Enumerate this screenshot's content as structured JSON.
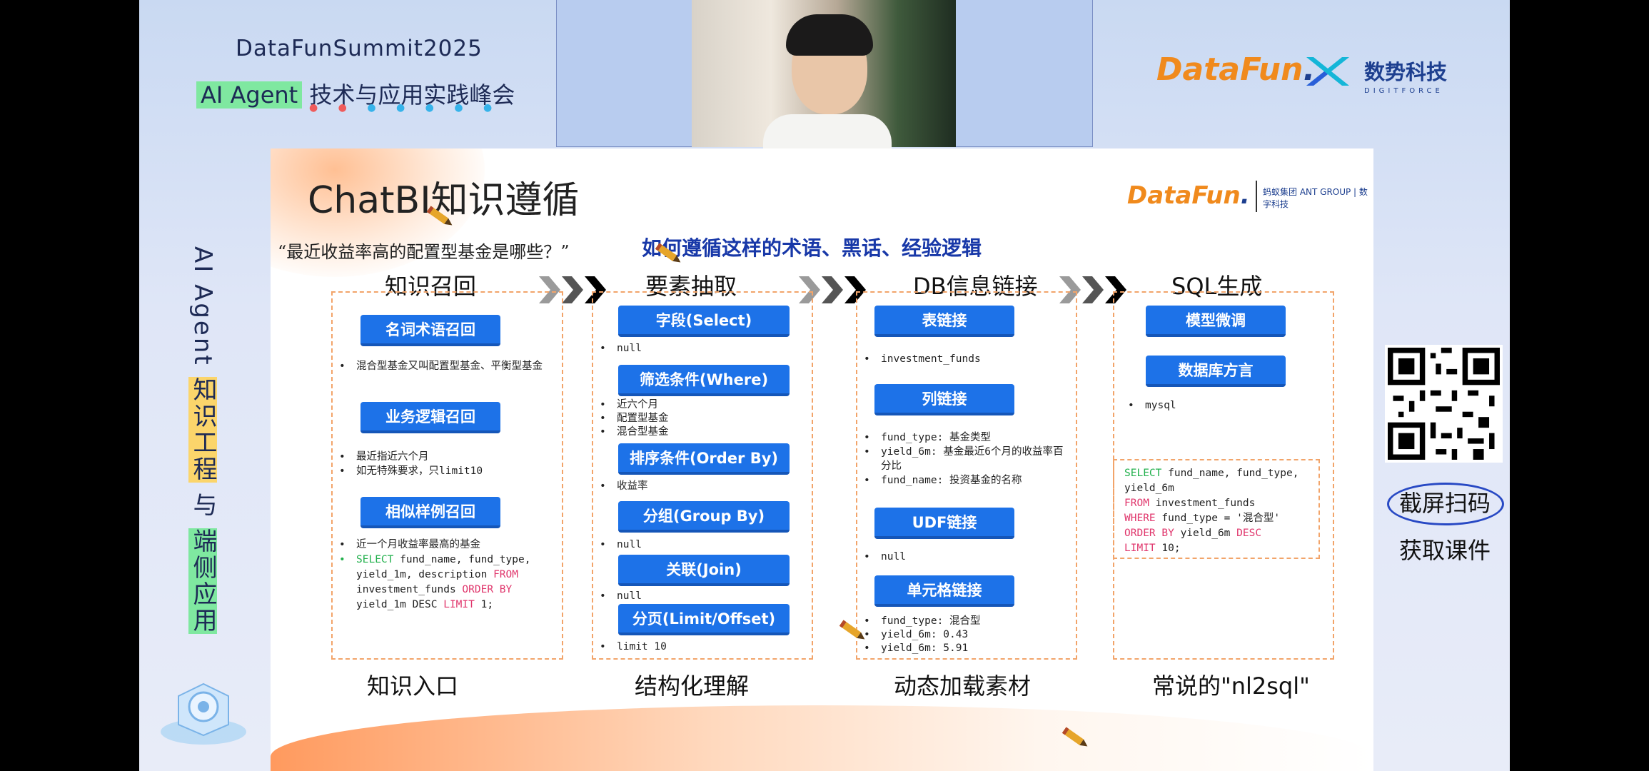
{
  "event": {
    "name": "DataFunSummit2025",
    "subtitle_highlight": "AI Agent",
    "subtitle_rest": "技术与应用实践峰会"
  },
  "brands": {
    "datafun_part1": "DataFun",
    "datafun_part2": ".",
    "digitforce_cn": "数势科技",
    "digitforce_en": "DIGITFORCE"
  },
  "vertical_title": {
    "part1": "AI Agent ",
    "part2": "知识工程",
    "part3": " 与 ",
    "part4": "端侧应用"
  },
  "qr": {
    "label1": "截屏扫码",
    "label2": "获取课件"
  },
  "slide": {
    "title": "ChatBI知识遵循",
    "brand_part1": "DataFun",
    "brand_part2": ".",
    "ant_logo_text": "蚂蚁集团 ANT GROUP | 数字科技",
    "question": "“最近收益率高的配置型基金是哪些？”",
    "question_highlight": "如何遵循这样的术语、黑话、经验逻辑",
    "columns": [
      {
        "header": "知识召回",
        "footer": "知识入口",
        "buttons": [
          "名词术语召回",
          "业务逻辑召回",
          "相似样例召回"
        ],
        "notes1": [
          "混合型基金又叫配置型基金、平衡型基金"
        ],
        "notes2": [
          "最近指近六个月",
          "如无特殊要求，只limit10"
        ],
        "notes3": [
          "近一个月收益率最高的基金"
        ],
        "sql": {
          "k1": "SELECT",
          "t1": " fund_name, fund_type, yield_1m, description ",
          "k2": "FROM",
          "t2": " investment_funds ",
          "k3": "ORDER BY",
          "t3": " yield_1m DESC ",
          "k4": "LIMIT",
          "t4": " 1;"
        }
      },
      {
        "header": "要素抽取",
        "footer": "结构化理解",
        "buttons": [
          "字段(Select)",
          "筛选条件(Where)",
          "排序条件(Order By)",
          "分组(Group By)",
          "关联(Join)",
          "分页(Limit/Offset)"
        ],
        "notes": [
          [
            "null"
          ],
          [
            "近六个月",
            "配置型基金",
            "混合型基金"
          ],
          [
            "收益率"
          ],
          [
            "null"
          ],
          [
            "null"
          ],
          [
            "limit 10"
          ]
        ]
      },
      {
        "header": "DB信息链接",
        "footer": "动态加载素材",
        "buttons": [
          "表链接",
          "列链接",
          "UDF链接",
          "单元格链接"
        ],
        "notes": [
          [
            "investment_funds"
          ],
          [
            "fund_type: 基金类型",
            "yield_6m: 基金最近6个月的收益率百分比",
            "fund_name: 投资基金的名称"
          ],
          [
            "null"
          ],
          [
            "fund_type: 混合型",
            "yield_6m: 0.43",
            "yield_6m: 5.91"
          ]
        ]
      },
      {
        "header": "SQL生成",
        "footer": "常说的\"nl2sql\"",
        "buttons": [
          "模型微调",
          "数据库方言"
        ],
        "notes": [
          [
            "mysql"
          ]
        ],
        "sql": {
          "k1": "SELECT",
          "t1": " fund_name, fund_type, yield_6m",
          "k2": "FROM",
          "t2": " investment_funds",
          "k3": "WHERE",
          "t3": " fund_type = '混合型'",
          "k4": "ORDER BY",
          "t4": " yield_6m ",
          "k5": "DESC",
          "k6": "LIMIT",
          "t6": " 10;"
        }
      }
    ]
  },
  "colors": {
    "button_blue": "#1d72e8",
    "dash_orange": "#f2a46a",
    "highlight_blue": "#1838a8",
    "sql_keyword_green": "#21b04c",
    "sql_keyword_pink": "#e0366c"
  }
}
